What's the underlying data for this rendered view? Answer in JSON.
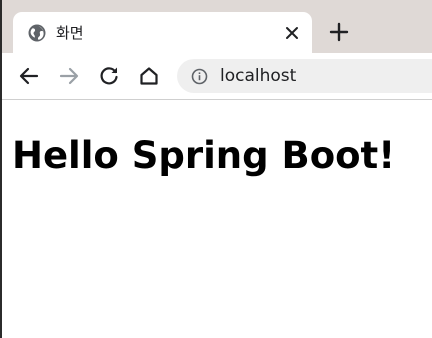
{
  "browser": {
    "tab": {
      "title": "화면",
      "favicon": "globe-icon"
    },
    "new_tab_icon": "plus-icon",
    "toolbar": {
      "back_icon": "arrow-left-icon",
      "forward_icon": "arrow-right-icon",
      "reload_icon": "reload-icon",
      "home_icon": "home-icon"
    },
    "address_bar": {
      "site_info_icon": "info-icon",
      "url": "localhost"
    }
  },
  "page": {
    "heading": "Hello Spring Boot!"
  },
  "colors": {
    "tabstrip_bg": "#dfd9d6",
    "omnibox_bg": "#efefef",
    "text": "#202124",
    "disabled_icon": "#9aa0a6"
  }
}
